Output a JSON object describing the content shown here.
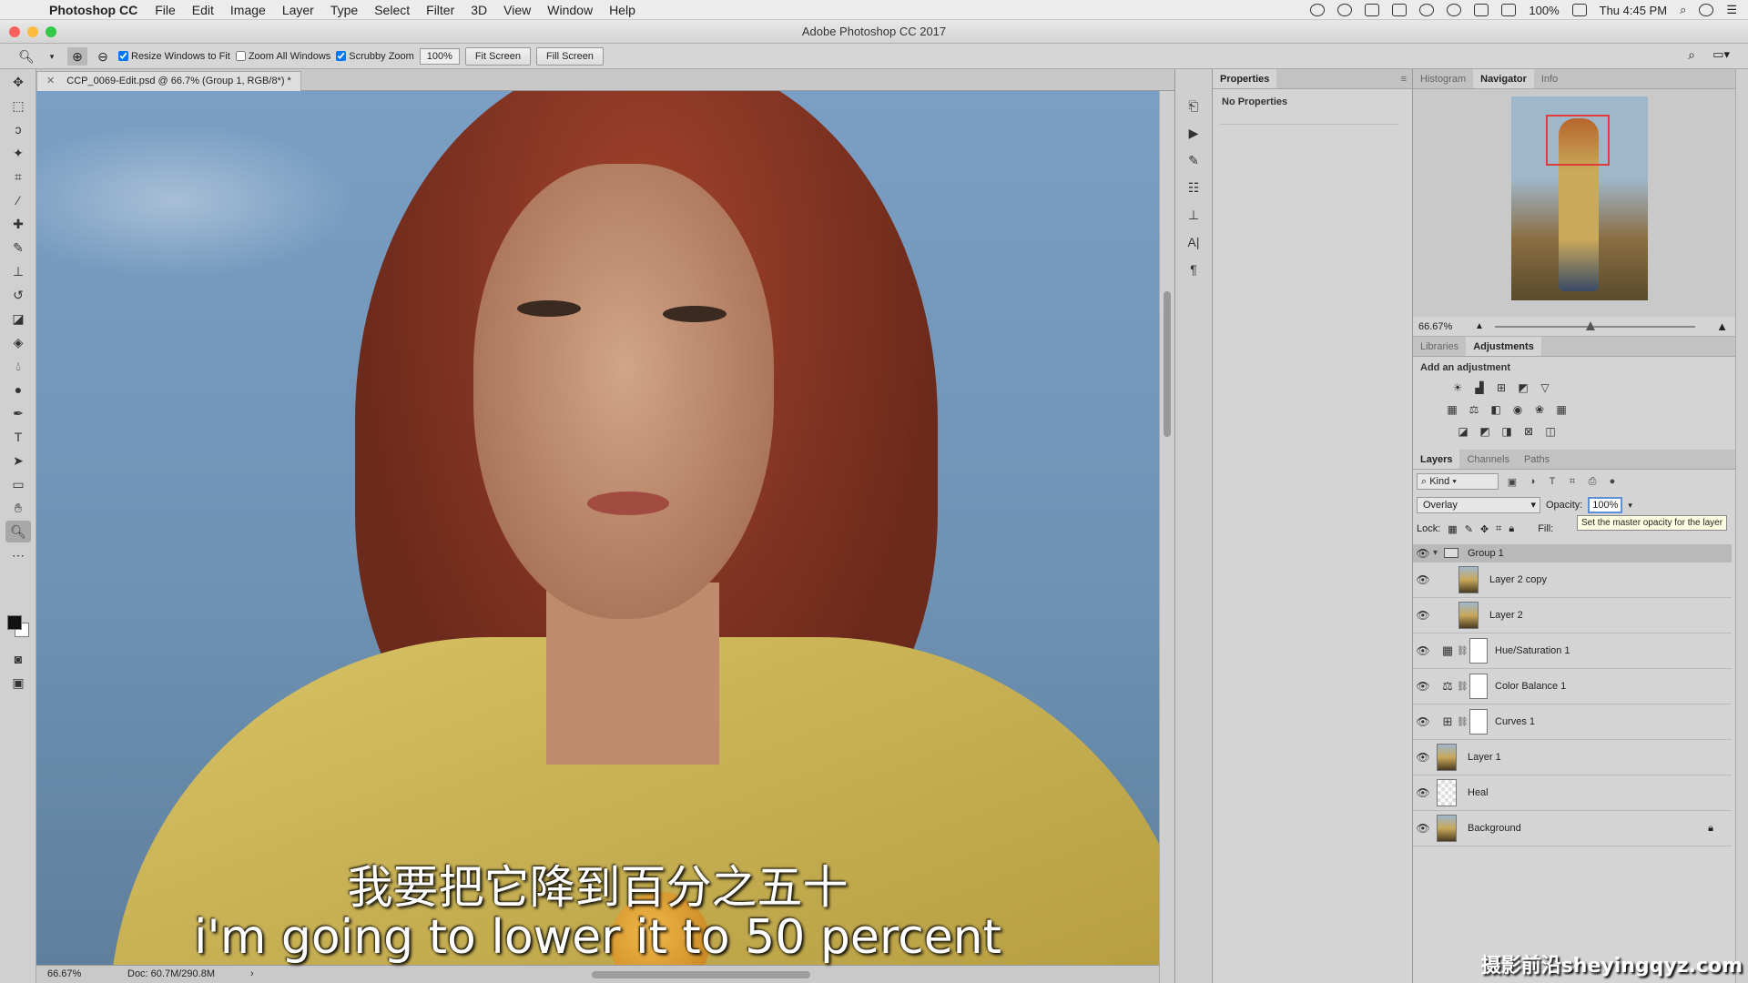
{
  "menubar": {
    "app_name": "Photoshop CC",
    "items": [
      "File",
      "Edit",
      "Image",
      "Layer",
      "Type",
      "Select",
      "Filter",
      "3D",
      "View",
      "Window",
      "Help"
    ],
    "battery": "100%",
    "clock": "Thu 4:45 PM"
  },
  "window": {
    "title": "Adobe Photoshop CC 2017"
  },
  "options": {
    "resize_windows": "Resize Windows to Fit",
    "zoom_all": "Zoom All Windows",
    "scrubby_zoom": "Scrubby Zoom",
    "zoom_value": "100%",
    "fit_screen": "Fit Screen",
    "fill_screen": "Fill Screen"
  },
  "document": {
    "tab_title": "CCP_0069-Edit.psd @ 66.7% (Group 1, RGB/8*) *",
    "zoom": "66.67%",
    "doc_size": "Doc: 60.7M/290.8M"
  },
  "properties": {
    "tab": "Properties",
    "empty": "No Properties"
  },
  "navigator": {
    "tabs": [
      "Histogram",
      "Navigator",
      "Info"
    ],
    "active_tab": "Navigator",
    "zoom": "66.67%"
  },
  "adjustments": {
    "tabs": [
      "Libraries",
      "Adjustments"
    ],
    "active_tab": "Adjustments",
    "label": "Add an adjustment"
  },
  "layers": {
    "tabs": [
      "Layers",
      "Channels",
      "Paths"
    ],
    "active_tab": "Layers",
    "kind": "Kind",
    "blend_mode": "Overlay",
    "opacity_label": "Opacity:",
    "opacity_value": "100%",
    "lock_label": "Lock:",
    "fill_label": "Fill:",
    "tooltip": "Set the master opacity for the layer",
    "items": [
      {
        "name": "Group 1",
        "kind": "group"
      },
      {
        "name": "Layer 2 copy",
        "kind": "photo",
        "indented": true
      },
      {
        "name": "Layer 2",
        "kind": "photo",
        "indented": true
      },
      {
        "name": "Hue/Saturation 1",
        "kind": "adjustment",
        "icon": "hue-saturation-icon"
      },
      {
        "name": "Color Balance 1",
        "kind": "adjustment",
        "icon": "color-balance-icon"
      },
      {
        "name": "Curves 1",
        "kind": "adjustment",
        "icon": "curves-icon"
      },
      {
        "name": "Layer 1",
        "kind": "photo"
      },
      {
        "name": "Heal",
        "kind": "transparent"
      },
      {
        "name": "Background",
        "kind": "photo",
        "locked": true
      }
    ]
  },
  "subtitles": {
    "chinese": "我要把它降到百分之五十",
    "english": "i'm going to lower it to 50 percent"
  },
  "watermark": "摄影前沿sheyingqyz.com",
  "colors": {
    "accent_blue": "#5b8fd6",
    "navigator_rect": "#e23b3b",
    "panel_bg": "#d4d4d4"
  }
}
